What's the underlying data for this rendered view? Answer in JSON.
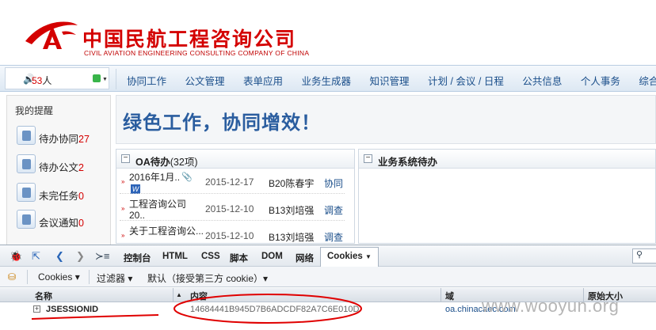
{
  "header": {
    "company_cn": "中国民航工程咨询公司",
    "company_en": "CIVIL AVIATION ENGINEERING CONSULTING COMPANY OF CHINA",
    "brand_color": "#d40000"
  },
  "userbar": {
    "speaker_icon": "speaker-icon",
    "online_count": "53",
    "online_suffix": "人"
  },
  "nav": {
    "items": [
      "协同工作",
      "公文管理",
      "表单应用",
      "业务生成器",
      "知识管理",
      "计划 / 会议 / 日程",
      "公共信息",
      "个人事务",
      "综合办"
    ]
  },
  "sidebar": {
    "title": "我的提醒",
    "items": [
      {
        "label": "待办协同",
        "count": "27"
      },
      {
        "label": "待办公文",
        "count": "2"
      },
      {
        "label": "未完任务",
        "count": "0"
      },
      {
        "label": "会议通知",
        "count": "0"
      }
    ]
  },
  "banner": {
    "slogan": "绿色工作，协同增效！"
  },
  "oa_panel": {
    "title": "OA待办",
    "subtitle": "(32项)",
    "rows": [
      {
        "title": "2016年1月..",
        "date": "2015-12-17",
        "who": "B20陈春宇",
        "type": "协同"
      },
      {
        "title": "工程咨询公司20..",
        "date": "2015-12-10",
        "who": "B13刘培强",
        "type": "调查"
      },
      {
        "title": "关于工程咨询公...",
        "date": "2015-12-10",
        "who": "B13刘培强",
        "type": "调查"
      }
    ]
  },
  "biz_panel": {
    "title": "业务系统待办"
  },
  "devtools": {
    "tabs": [
      "控制台",
      "HTML",
      "CSS",
      "脚本",
      "DOM",
      "网络",
      "Cookies"
    ],
    "active_tab": "Cookies",
    "search_placeholder": "",
    "subbar": [
      "Cookies ▾",
      "过滤器 ▾",
      "默认（接受第三方 cookie）▾"
    ],
    "columns": {
      "name": "名称",
      "content": "内容",
      "domain": "域",
      "size": "原始大小"
    },
    "cookie": {
      "name": "JSESSIONID",
      "value": "14684441B945D7B6ADCDF82A7C6E010D",
      "domain": "oa.chinacaec.com"
    }
  },
  "watermark": "www.wooyun.org",
  "colors": {
    "link": "#1a4e8a",
    "count": "#d40000",
    "annotation": "#e00000"
  }
}
